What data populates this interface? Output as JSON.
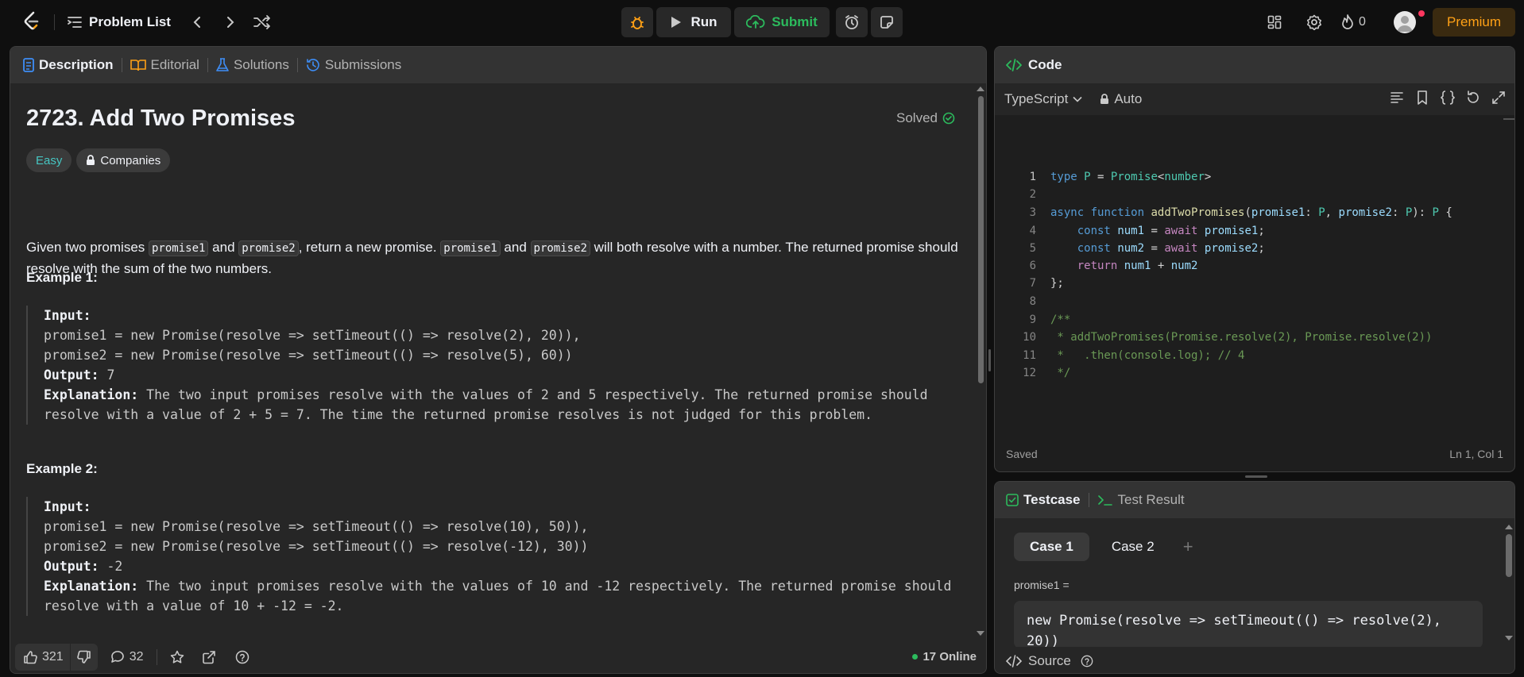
{
  "nav": {
    "problem_list": "Problem List",
    "run_label": "Run",
    "submit_label": "Submit",
    "streak_count": "0",
    "premium_label": "Premium"
  },
  "left_tabs": [
    "Description",
    "Editorial",
    "Solutions",
    "Submissions"
  ],
  "problem": {
    "title": "2723. Add Two Promises",
    "status": "Solved",
    "difficulty": "Easy",
    "companies": "Companies",
    "desc_parts": [
      "Given two promises ",
      "promise1",
      " and ",
      "promise2",
      ", return a new promise. ",
      "promise1",
      " and ",
      "promise2",
      " will both resolve with a number. The returned promise should resolve with the sum of the two numbers."
    ],
    "examples": [
      {
        "heading": "Example 1:",
        "input_label": "Input:",
        "input_lines": [
          "promise1 = new Promise(resolve => setTimeout(() => resolve(2), 20)),",
          "promise2 = new Promise(resolve => setTimeout(() => resolve(5), 60))"
        ],
        "output_label": "Output:",
        "output": " 7",
        "explanation_label": "Explanation:",
        "explanation": " The two input promises resolve with the values of 2 and 5 respectively. The returned promise should resolve with a value of 2 + 5 = 7. The time the returned promise resolves is not judged for this problem."
      },
      {
        "heading": "Example 2:",
        "input_label": "Input:",
        "input_lines": [
          "promise1 = new Promise(resolve => setTimeout(() => resolve(10), 50)),",
          "promise2 = new Promise(resolve => setTimeout(() => resolve(-12), 30))"
        ],
        "output_label": "Output:",
        "output": " -2",
        "explanation_label": "Explanation:",
        "explanation": " The two input promises resolve with the values of 10 and -12 respectively. The returned promise should resolve with a value of 10 + -12 = -2."
      }
    ]
  },
  "footer": {
    "likes": "321",
    "comments": "32",
    "online": "17 Online"
  },
  "code": {
    "header": "Code",
    "language": "TypeScript",
    "mode": "Auto",
    "status": "Saved",
    "cursor": "Ln 1, Col 1",
    "line_numbers": [
      "1",
      "2",
      "3",
      "4",
      "5",
      "6",
      "7",
      "8",
      "9",
      "10",
      "11",
      "12"
    ]
  },
  "testcase": {
    "tab_testcase": "Testcase",
    "tab_result": "Test Result",
    "cases": [
      "Case 1",
      "Case 2"
    ],
    "add": "+",
    "var_label": "promise1 =",
    "value": "new Promise(resolve => setTimeout(() => resolve(2), 20))",
    "source": "Source"
  },
  "colors": {
    "accent_orange": "#ffa116",
    "submit_green": "#2cbb5d",
    "easy_teal": "#46c6c2"
  }
}
